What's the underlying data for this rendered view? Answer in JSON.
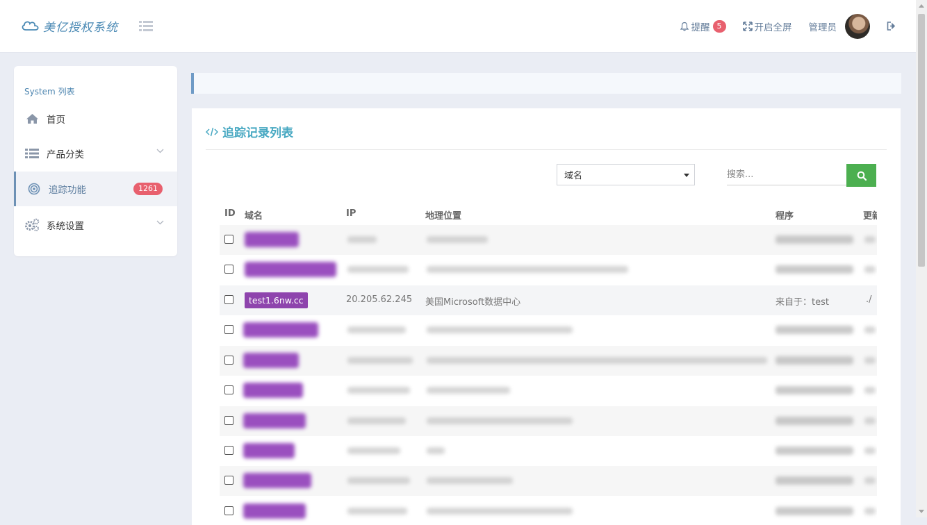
{
  "header": {
    "logo_text": "美亿授权系统",
    "notify_label": "提醒",
    "notify_count": "5",
    "fullscreen_label": "开启全屏",
    "user_label": "管理员"
  },
  "sidebar": {
    "title": "System 列表",
    "items": [
      {
        "label": "首页",
        "icon": "home-icon"
      },
      {
        "label": "产品分类",
        "icon": "list-icon"
      },
      {
        "label": "追踪功能",
        "icon": "target-icon",
        "badge": "1261"
      },
      {
        "label": "系统设置",
        "icon": "gears-icon"
      }
    ]
  },
  "main": {
    "title": "追踪记录列表",
    "filter_value": "域名",
    "search_placeholder": "搜索...",
    "table": {
      "headers": [
        "ID",
        "域名",
        "IP",
        "地理位置",
        "程序",
        "更新"
      ],
      "visible_row": {
        "domain": "test1.6nw.cc",
        "ip": "20.205.62.245",
        "location": "美国Microsoft数据中心",
        "program": "来自于：test",
        "update": "./"
      }
    }
  },
  "colors": {
    "accent": "#47a8c2",
    "badge": "#e8606e",
    "domain_tag": "#8e44ad",
    "search_button": "#4caf50"
  }
}
